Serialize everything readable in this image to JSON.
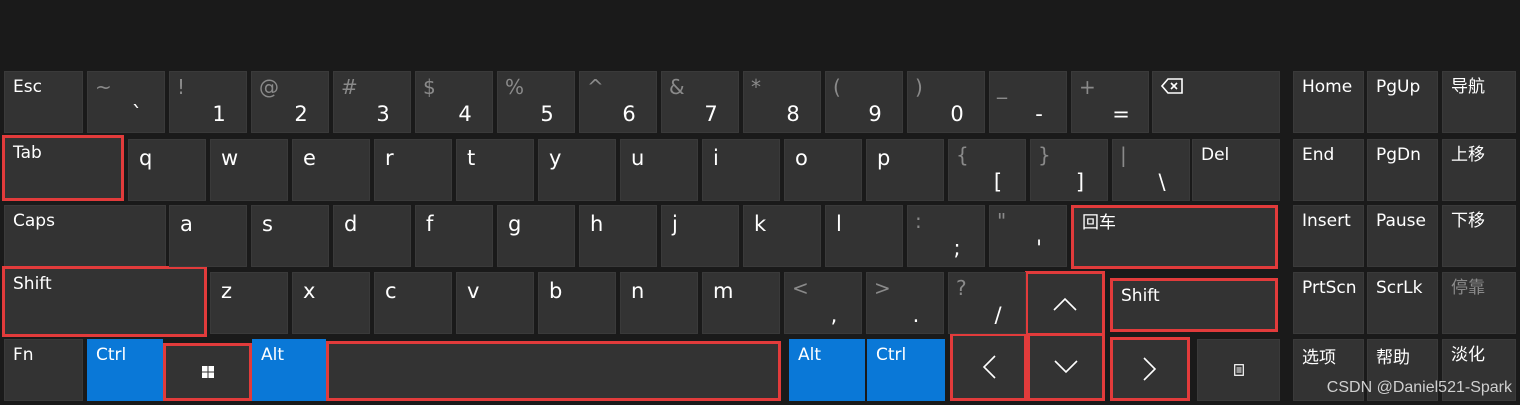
{
  "keyboard": {
    "row1": {
      "esc": "Esc",
      "keys": [
        {
          "shift": "~",
          "main": "`"
        },
        {
          "shift": "!",
          "main": "1"
        },
        {
          "shift": "@",
          "main": "2"
        },
        {
          "shift": "#",
          "main": "3"
        },
        {
          "shift": "$",
          "main": "4"
        },
        {
          "shift": "%",
          "main": "5"
        },
        {
          "shift": "^",
          "main": "6"
        },
        {
          "shift": "&",
          "main": "7"
        },
        {
          "shift": "*",
          "main": "8"
        },
        {
          "shift": "(",
          "main": "9"
        },
        {
          "shift": ")",
          "main": "0"
        },
        {
          "shift": "_",
          "main": "-"
        },
        {
          "shift": "+",
          "main": "="
        }
      ],
      "backspace_icon": "backspace-icon"
    },
    "row2": {
      "tab": "Tab",
      "letters": [
        "q",
        "w",
        "e",
        "r",
        "t",
        "y",
        "u",
        "i",
        "o",
        "p"
      ],
      "punct": [
        {
          "shift": "{",
          "main": "["
        },
        {
          "shift": "}",
          "main": "]"
        },
        {
          "shift": "|",
          "main": "\\"
        }
      ],
      "del": "Del"
    },
    "row3": {
      "caps": "Caps",
      "letters": [
        "a",
        "s",
        "d",
        "f",
        "g",
        "h",
        "j",
        "k",
        "l"
      ],
      "punct": [
        {
          "shift": ":",
          "main": ";"
        },
        {
          "shift": "\"",
          "main": "'"
        }
      ],
      "enter": "回车"
    },
    "row4": {
      "shift_left": "Shift",
      "letters": [
        "z",
        "x",
        "c",
        "v",
        "b",
        "n",
        "m"
      ],
      "punct": [
        {
          "shift": "<",
          "main": ","
        },
        {
          "shift": ">",
          "main": "."
        },
        {
          "shift": "?",
          "main": "/"
        }
      ],
      "shift_right": "Shift"
    },
    "row5": {
      "fn": "Fn",
      "ctrl_left": "Ctrl",
      "alt_left": "Alt",
      "alt_right": "Alt",
      "ctrl_right": "Ctrl"
    }
  },
  "nav": {
    "home": "Home",
    "pgup": "PgUp",
    "nav": "导航",
    "end": "End",
    "pgdn": "PgDn",
    "moveup": "上移",
    "insert": "Insert",
    "pause": "Pause",
    "movedown": "下移",
    "prtscn": "PrtScn",
    "scrlk": "ScrLk",
    "dock": "停靠",
    "options": "选项",
    "help": "帮助",
    "fade": "淡化"
  },
  "watermark": "CSDN @Daniel521-Spark",
  "colors": {
    "background": "#1a1a1a",
    "key": "#333333",
    "accent": "#0a78d7",
    "highlight": "#e23b3b"
  }
}
